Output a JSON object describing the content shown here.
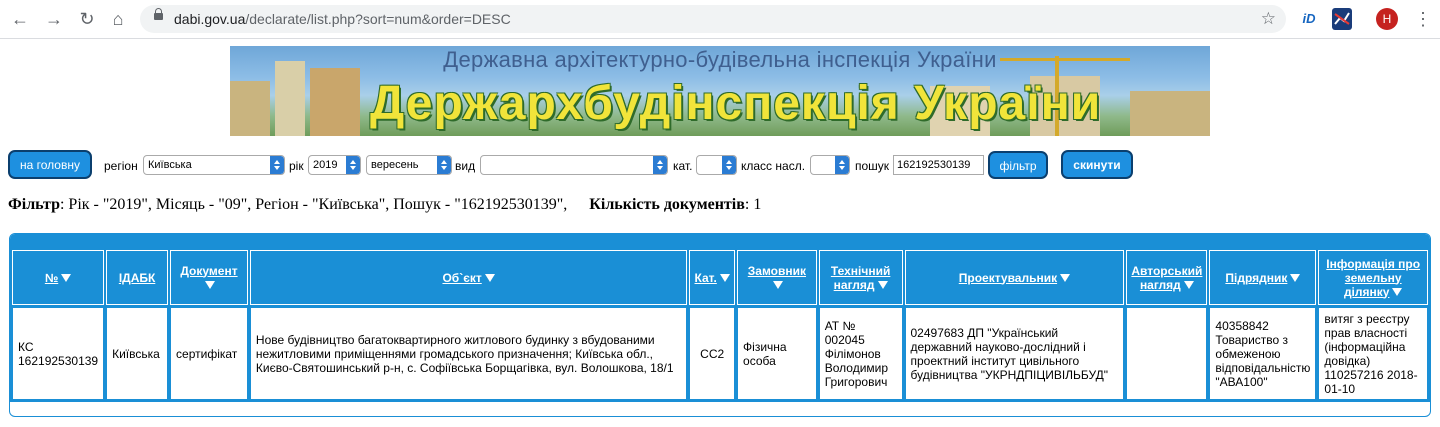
{
  "browser": {
    "url_host": "dabi.gov.ua",
    "url_path": "/declarate/list.php?sort=num&order=DESC",
    "avatar_letter": "H",
    "ext1_label": "iD"
  },
  "banner": {
    "subtitle": "Державна архітектурно-будівельна інспекція України",
    "title": "Держархбудінспекція України"
  },
  "filters": {
    "home_button": "на головну",
    "region_label": "регіон",
    "region_value": "Київська",
    "year_label": "рік",
    "year_value": "2019",
    "month_value": "вересень",
    "type_label": "вид",
    "type_value": "",
    "cat_label": "кат.",
    "cat_value": "",
    "class_label": "класс насл.",
    "class_value": "",
    "search_label": "пошук",
    "search_value": "162192530139",
    "filter_button": "фільтр",
    "reset_button": "скинути"
  },
  "summary": {
    "filter_label": "Фільтр",
    "filter_text": ": Рік - \"2019\", Місяць - \"09\", Регіон - \"Київська\", Пошук - \"162192530139\",",
    "count_label": "Кількість документів",
    "count_text": ": 1"
  },
  "table": {
    "headers": [
      "№",
      "ІДАБК",
      "Документ",
      "Об`єкт",
      "Кат.",
      "Замовник",
      "Технічний нагляд",
      "Проектувальник",
      "Авторський нагляд",
      "Підрядник",
      "Інформація про земельну ділянку"
    ],
    "rows": [
      {
        "num": "КС 162192530139",
        "idabk": "Київська",
        "doc": "сертифікат",
        "object": "Нове будівництво багатоквартирного житлового будинку з вбудованими нежитловими приміщеннями громадського призначення; Київська обл., Києво-Святошинський р-н, с. Софіївська Борщагівка, вул. Волошкова, 18/1",
        "cat": "СС2",
        "customer": "Фізична особа",
        "tech": "АТ № 002045 Філімонов Володимир Григорович",
        "designer": "02497683 ДП \"Український державний науково-дослідний і проектний інститут цивільного будівництва \"УКРНДПІЦИВІЛЬБУД\"",
        "author": "",
        "contractor": "40358842 Товариство з обмеженою відповідальністю \"АВА100\"",
        "land": "витяг з реєстру прав власності (інформаційна довідка) 110257216 2018-01-10"
      }
    ]
  }
}
